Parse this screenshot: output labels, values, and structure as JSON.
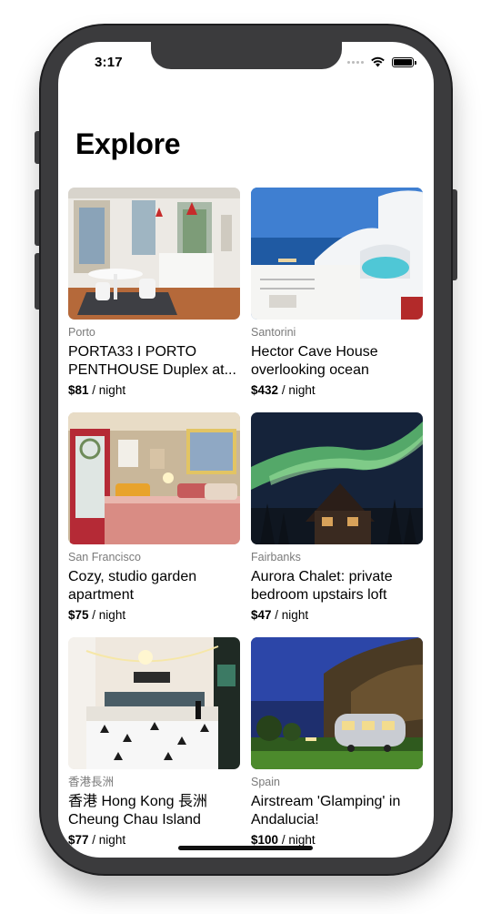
{
  "status": {
    "time": "3:17"
  },
  "header": {
    "title": "Explore"
  },
  "price_unit": "/ night",
  "listings": [
    {
      "city": "Porto",
      "name": "PORTA33 I PORTO PENTHOUSE Duplex at...",
      "price": "$81"
    },
    {
      "city": "Santorini",
      "name": "Hector Cave House overlooking ocean",
      "price": "$432"
    },
    {
      "city": "San Francisco",
      "name": "Cozy, studio garden apartment",
      "price": "$75"
    },
    {
      "city": "Fairbanks",
      "name": "Aurora Chalet: private bedroom upstairs loft",
      "price": "$47"
    },
    {
      "city": "香港長洲",
      "name": "香港 Hong Kong 長洲 Cheung Chau Island",
      "price": "$77"
    },
    {
      "city": "Spain",
      "name": "Airstream 'Glamping' in Andalucia!",
      "price": "$100"
    }
  ],
  "colors": {
    "frame": "#3b3b3d",
    "city_text": "#7a7a7a"
  },
  "icons": [
    "cellular-signal-icon",
    "wifi-icon",
    "battery-icon"
  ]
}
